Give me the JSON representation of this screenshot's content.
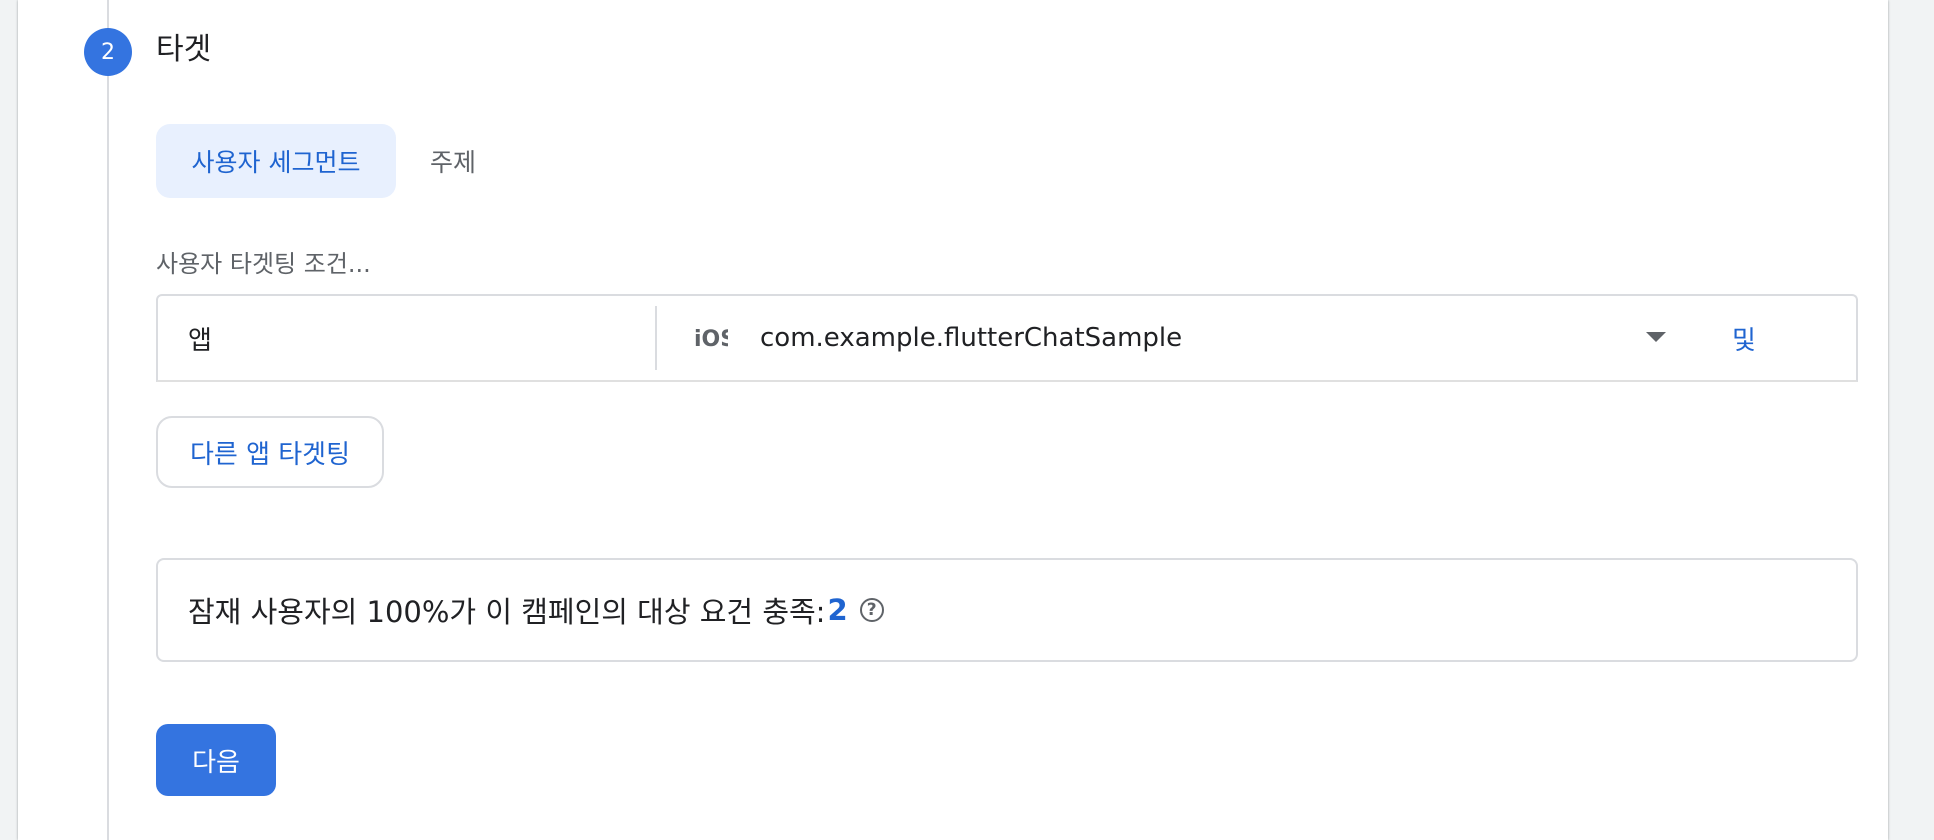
{
  "step": {
    "number": "2",
    "title": "타겟"
  },
  "tabs": [
    {
      "label": "사용자 세그먼트",
      "active": true
    },
    {
      "label": "주제",
      "active": false
    }
  ],
  "targeting": {
    "condition_label": "사용자 타겟팅 조건...",
    "row": {
      "field": "앱",
      "platform_icon": "ios-icon",
      "platform_text": "iOS",
      "app_id": "com.example.flutterChatSample",
      "and_label": "및"
    },
    "other_app_button": "다른 앱 타겟팅"
  },
  "reach": {
    "text": "잠재 사용자의 100%가 이 캠페인의 대상 요건 충족:",
    "count": "2",
    "help_icon": "help-circle-icon"
  },
  "next_button": "다음",
  "colors": {
    "accent": "#3474e0",
    "link": "#1f64d0",
    "active_tab_bg": "#e8f0fe",
    "border": "#dadce0"
  }
}
